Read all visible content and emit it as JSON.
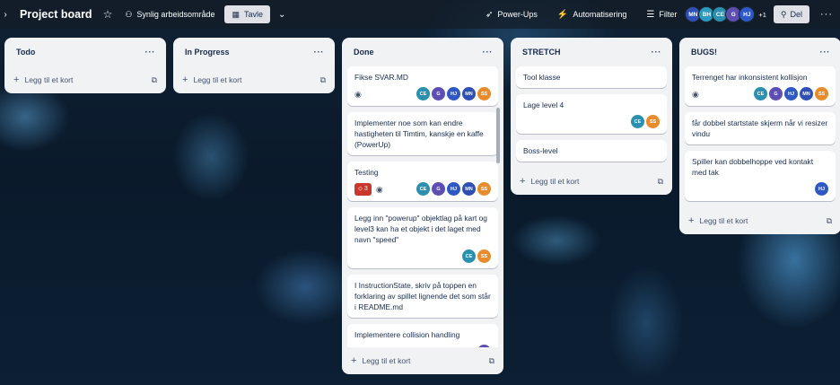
{
  "header": {
    "board_title": "Project board",
    "visibility_label": "Synlig arbeidsområde",
    "view_label": "Tavle",
    "powerups_label": "Power-Ups",
    "automation_label": "Automatisering",
    "filter_label": "Filter",
    "members": [
      "MN",
      "BH",
      "CE",
      "G",
      "HJ"
    ],
    "extra_members": "+1",
    "share_label": "Del"
  },
  "colors": {
    "MN": "#2f4fb5",
    "BH": "#2a9bbf",
    "CE": "#2b8fb0",
    "G": "#5e4db2",
    "HJ": "#2d58c6",
    "SS": "#e88b2a"
  },
  "lists": {
    "todo": {
      "title": "Todo",
      "add_label": "Legg til et kort"
    },
    "in_progress": {
      "title": "In Progress",
      "add_label": "Legg til et kort"
    },
    "done": {
      "title": "Done",
      "add_label": "Legg til et kort",
      "cards": [
        {
          "title": "Fikse SVAR.MD",
          "members": [
            "CE",
            "G",
            "HJ",
            "MN",
            "SS"
          ]
        },
        {
          "title": "Implementer noe som kan endre hastigheten til Timtim, kanskje en kaffe (PowerUp)"
        },
        {
          "title": "Testing",
          "badge": "3",
          "members": [
            "CE",
            "G",
            "HJ",
            "MN",
            "SS"
          ]
        },
        {
          "title": "Legg inn \"powerup\" objektlag på kart og level3 kan ha et objekt i det laget med navn \"speed\"",
          "members": [
            "CE",
            "SS"
          ]
        },
        {
          "title": "I InstructionState, skriv på toppen en forklaring av spillet lignende det som står i README.md"
        },
        {
          "title": "Implementere collision handling",
          "members": [
            "G"
          ]
        }
      ]
    },
    "stretch": {
      "title": "STRETCH",
      "add_label": "Legg til et kort",
      "cards": [
        {
          "title": "Tool klasse"
        },
        {
          "title": "Lage level 4",
          "members": [
            "CE",
            "SS"
          ]
        },
        {
          "title": "Boss-level"
        }
      ]
    },
    "bugs": {
      "title": "BUGS!",
      "add_label": "Legg til et kort",
      "cards": [
        {
          "title": "Terrenget har inkonsistent kollisjon",
          "members": [
            "CE",
            "G",
            "HJ",
            "MN",
            "SS"
          ]
        },
        {
          "title": "får dobbel startstate skjerm når vi resizer vindu"
        },
        {
          "title": "Spiller kan dobbelhoppe ved kontakt med tak",
          "members": [
            "HJ"
          ]
        }
      ]
    }
  }
}
